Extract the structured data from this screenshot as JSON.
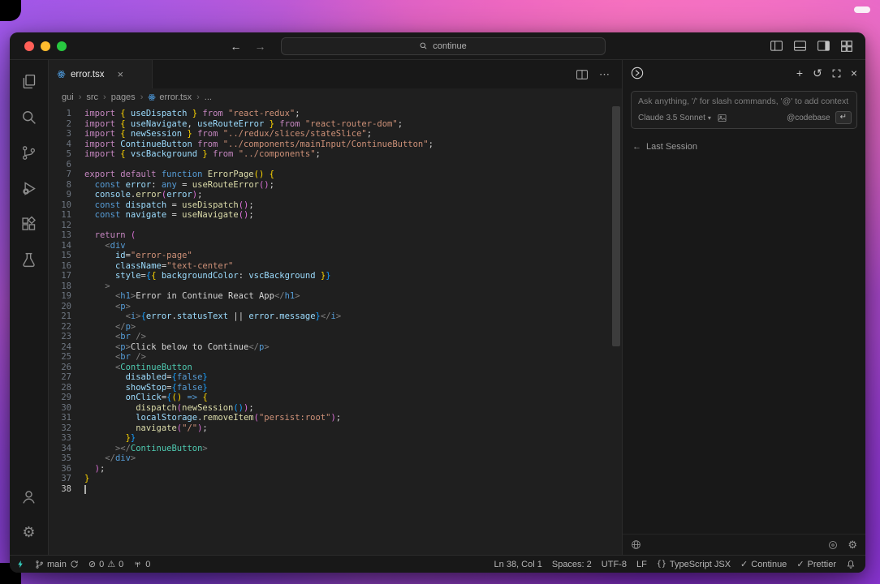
{
  "titlebar": {
    "search": "continue"
  },
  "tabs": [
    {
      "label": "error.tsx"
    }
  ],
  "breadcrumbs": [
    "gui",
    "src",
    "pages",
    "error.tsx",
    "..."
  ],
  "panel": {
    "placeholder": "Ask anything, '/' for slash commands, '@' to add context",
    "model": "Claude 3.5 Sonnet",
    "codebase": "@codebase",
    "enter_glyph": "↵",
    "last_session_arrow": "←",
    "last_session": "Last Session"
  },
  "status": {
    "left": {
      "branch": "main",
      "errors": "0",
      "warnings": "0",
      "ports": "0"
    },
    "right": {
      "position": "Ln 38, Col 1",
      "indent": "Spaces: 2",
      "encoding": "UTF-8",
      "eol": "LF",
      "language": "TypeScript JSX",
      "continue_label": "Continue",
      "prettier_label": "Prettier"
    }
  },
  "glyphs": {
    "back": "←",
    "forward": "→",
    "plus": "+",
    "history": "↺",
    "close": "×",
    "more": "⋯",
    "crumb_sep": "›",
    "error_icon": "⊘",
    "warning_icon": "⚠",
    "check": "✓",
    "gear": "⚙",
    "chevron_down": "▾",
    "lang_icon": "{}"
  },
  "colors": {
    "editor_bg": "#1f1f1f",
    "chrome_bg": "#181818",
    "accent_remote": "#35d0c0",
    "traffic_close": "#ff5f57",
    "traffic_min": "#febc2e",
    "traffic_max": "#28c840"
  },
  "editor": {
    "active_line": 38,
    "lines": [
      [
        [
          "k",
          "import "
        ],
        [
          "y",
          "{"
        ],
        [
          "v",
          " useDispatch "
        ],
        [
          "y",
          "}"
        ],
        [
          "k",
          " from "
        ],
        [
          "s",
          "\"react-redux\""
        ],
        [
          "d",
          ";"
        ]
      ],
      [
        [
          "k",
          "import "
        ],
        [
          "y",
          "{"
        ],
        [
          "v",
          " useNavigate"
        ],
        [
          "d",
          ", "
        ],
        [
          "v",
          "useRouteError "
        ],
        [
          "y",
          "}"
        ],
        [
          "k",
          " from "
        ],
        [
          "s",
          "\"react-router-dom\""
        ],
        [
          "d",
          ";"
        ]
      ],
      [
        [
          "k",
          "import "
        ],
        [
          "y",
          "{"
        ],
        [
          "v",
          " newSession "
        ],
        [
          "y",
          "}"
        ],
        [
          "k",
          " from "
        ],
        [
          "s",
          "\"../redux/slices/stateSlice\""
        ],
        [
          "d",
          ";"
        ]
      ],
      [
        [
          "k",
          "import "
        ],
        [
          "v",
          "ContinueButton "
        ],
        [
          "k",
          "from "
        ],
        [
          "s",
          "\"../components/mainInput/ContinueButton\""
        ],
        [
          "d",
          ";"
        ]
      ],
      [
        [
          "k",
          "import "
        ],
        [
          "y",
          "{"
        ],
        [
          "v",
          " vscBackground "
        ],
        [
          "y",
          "}"
        ],
        [
          "k",
          " from "
        ],
        [
          "s",
          "\"../components\""
        ],
        [
          "d",
          ";"
        ]
      ],
      [],
      [
        [
          "k",
          "export default "
        ],
        [
          "b",
          "function "
        ],
        [
          "f",
          "ErrorPage"
        ],
        [
          "y",
          "()"
        ],
        [
          "d",
          " "
        ],
        [
          "y",
          "{"
        ]
      ],
      [
        [
          "d",
          "  "
        ],
        [
          "b",
          "const "
        ],
        [
          "v",
          "error"
        ],
        [
          "d",
          ": "
        ],
        [
          "b",
          "any"
        ],
        [
          "d",
          " = "
        ],
        [
          "f",
          "useRouteError"
        ],
        [
          "m",
          "()"
        ],
        [
          "d",
          ";"
        ]
      ],
      [
        [
          "d",
          "  "
        ],
        [
          "v",
          "console"
        ],
        [
          "d",
          "."
        ],
        [
          "f",
          "error"
        ],
        [
          "m",
          "("
        ],
        [
          "v",
          "error"
        ],
        [
          "m",
          ")"
        ],
        [
          "d",
          ";"
        ]
      ],
      [
        [
          "d",
          "  "
        ],
        [
          "b",
          "const "
        ],
        [
          "v",
          "dispatch"
        ],
        [
          "d",
          " = "
        ],
        [
          "f",
          "useDispatch"
        ],
        [
          "m",
          "()"
        ],
        [
          "d",
          ";"
        ]
      ],
      [
        [
          "d",
          "  "
        ],
        [
          "b",
          "const "
        ],
        [
          "v",
          "navigate"
        ],
        [
          "d",
          " = "
        ],
        [
          "f",
          "useNavigate"
        ],
        [
          "m",
          "()"
        ],
        [
          "d",
          ";"
        ]
      ],
      [],
      [
        [
          "d",
          "  "
        ],
        [
          "k",
          "return"
        ],
        [
          "d",
          " "
        ],
        [
          "m",
          "("
        ]
      ],
      [
        [
          "d",
          "    "
        ],
        [
          "g",
          "<"
        ],
        [
          "t",
          "div"
        ]
      ],
      [
        [
          "d",
          "      "
        ],
        [
          "v",
          "id"
        ],
        [
          "d",
          "="
        ],
        [
          "s",
          "\"error-page\""
        ]
      ],
      [
        [
          "d",
          "      "
        ],
        [
          "v",
          "className"
        ],
        [
          "d",
          "="
        ],
        [
          "s",
          "\"text-center\""
        ]
      ],
      [
        [
          "d",
          "      "
        ],
        [
          "v",
          "style"
        ],
        [
          "d",
          "="
        ],
        [
          "u",
          "{"
        ],
        [
          "y",
          "{"
        ],
        [
          "d",
          " "
        ],
        [
          "v",
          "backgroundColor"
        ],
        [
          "d",
          ": "
        ],
        [
          "v",
          "vscBackground"
        ],
        [
          "d",
          " "
        ],
        [
          "y",
          "}"
        ],
        [
          "u",
          "}"
        ]
      ],
      [
        [
          "d",
          "    "
        ],
        [
          "g",
          ">"
        ]
      ],
      [
        [
          "d",
          "      "
        ],
        [
          "g",
          "<"
        ],
        [
          "t",
          "h1"
        ],
        [
          "g",
          ">"
        ],
        [
          "d",
          "Error in Continue React App"
        ],
        [
          "g",
          "</"
        ],
        [
          "t",
          "h1"
        ],
        [
          "g",
          ">"
        ]
      ],
      [
        [
          "d",
          "      "
        ],
        [
          "g",
          "<"
        ],
        [
          "t",
          "p"
        ],
        [
          "g",
          ">"
        ]
      ],
      [
        [
          "d",
          "        "
        ],
        [
          "g",
          "<"
        ],
        [
          "t",
          "i"
        ],
        [
          "g",
          ">"
        ],
        [
          "u",
          "{"
        ],
        [
          "v",
          "error"
        ],
        [
          "d",
          "."
        ],
        [
          "v",
          "statusText"
        ],
        [
          "d",
          " || "
        ],
        [
          "v",
          "error"
        ],
        [
          "d",
          "."
        ],
        [
          "v",
          "message"
        ],
        [
          "u",
          "}"
        ],
        [
          "g",
          "</"
        ],
        [
          "t",
          "i"
        ],
        [
          "g",
          ">"
        ]
      ],
      [
        [
          "d",
          "      "
        ],
        [
          "g",
          "</"
        ],
        [
          "t",
          "p"
        ],
        [
          "g",
          ">"
        ]
      ],
      [
        [
          "d",
          "      "
        ],
        [
          "g",
          "<"
        ],
        [
          "t",
          "br"
        ],
        [
          "g",
          " />"
        ]
      ],
      [
        [
          "d",
          "      "
        ],
        [
          "g",
          "<"
        ],
        [
          "t",
          "p"
        ],
        [
          "g",
          ">"
        ],
        [
          "d",
          "Click below to Continue"
        ],
        [
          "g",
          "</"
        ],
        [
          "t",
          "p"
        ],
        [
          "g",
          ">"
        ]
      ],
      [
        [
          "d",
          "      "
        ],
        [
          "g",
          "<"
        ],
        [
          "t",
          "br"
        ],
        [
          "g",
          " />"
        ]
      ],
      [
        [
          "d",
          "      "
        ],
        [
          "g",
          "<"
        ],
        [
          "c",
          "ContinueButton"
        ]
      ],
      [
        [
          "d",
          "        "
        ],
        [
          "v",
          "disabled"
        ],
        [
          "d",
          "="
        ],
        [
          "u",
          "{"
        ],
        [
          "b",
          "false"
        ],
        [
          "u",
          "}"
        ]
      ],
      [
        [
          "d",
          "        "
        ],
        [
          "v",
          "showStop"
        ],
        [
          "d",
          "="
        ],
        [
          "u",
          "{"
        ],
        [
          "b",
          "false"
        ],
        [
          "u",
          "}"
        ]
      ],
      [
        [
          "d",
          "        "
        ],
        [
          "v",
          "onClick"
        ],
        [
          "d",
          "="
        ],
        [
          "u",
          "{"
        ],
        [
          "y",
          "()"
        ],
        [
          "b",
          " => "
        ],
        [
          "y",
          "{"
        ]
      ],
      [
        [
          "d",
          "          "
        ],
        [
          "f",
          "dispatch"
        ],
        [
          "m",
          "("
        ],
        [
          "f",
          "newSession"
        ],
        [
          "u",
          "()"
        ],
        [
          "m",
          ")"
        ],
        [
          "d",
          ";"
        ]
      ],
      [
        [
          "d",
          "          "
        ],
        [
          "v",
          "localStorage"
        ],
        [
          "d",
          "."
        ],
        [
          "f",
          "removeItem"
        ],
        [
          "m",
          "("
        ],
        [
          "s",
          "\"persist:root\""
        ],
        [
          "m",
          ")"
        ],
        [
          "d",
          ";"
        ]
      ],
      [
        [
          "d",
          "          "
        ],
        [
          "f",
          "navigate"
        ],
        [
          "m",
          "("
        ],
        [
          "s",
          "\"/\""
        ],
        [
          "m",
          ")"
        ],
        [
          "d",
          ";"
        ]
      ],
      [
        [
          "d",
          "        "
        ],
        [
          "y",
          "}"
        ],
        [
          "u",
          "}"
        ]
      ],
      [
        [
          "d",
          "      "
        ],
        [
          "g",
          "></"
        ],
        [
          "c",
          "ContinueButton"
        ],
        [
          "g",
          ">"
        ]
      ],
      [
        [
          "d",
          "    "
        ],
        [
          "g",
          "</"
        ],
        [
          "t",
          "div"
        ],
        [
          "g",
          ">"
        ]
      ],
      [
        [
          "d",
          "  "
        ],
        [
          "m",
          ")"
        ],
        [
          "d",
          ";"
        ]
      ],
      [
        [
          "y",
          "}"
        ]
      ],
      []
    ]
  }
}
